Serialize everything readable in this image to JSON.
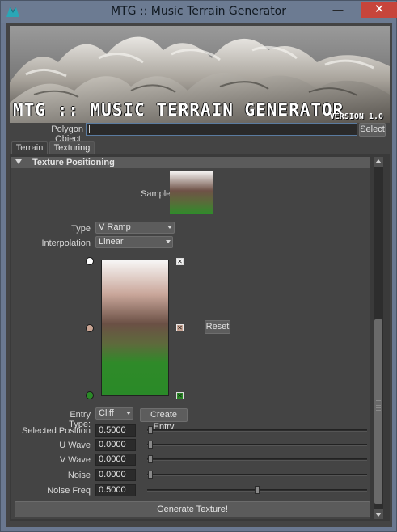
{
  "window": {
    "title": "MTG :: Music Terrain Generator",
    "minimize_glyph": "—",
    "maximize_glyph": "□",
    "close_glyph": "✕"
  },
  "banner": {
    "title": "MTG :: MUSIC TERRAIN GENERATOR",
    "version": "VERSION 1.0"
  },
  "polygon": {
    "label": "Polygon Object:",
    "value": "",
    "select_label": "Select"
  },
  "tabs": [
    {
      "label": "Terrain",
      "active": false
    },
    {
      "label": "Texturing",
      "active": true
    }
  ],
  "section": {
    "title": "Texture Positioning",
    "expanded": true
  },
  "sample": {
    "label": "Sample"
  },
  "type": {
    "label": "Type",
    "selected": "V Ramp"
  },
  "interpolation": {
    "label": "Interpolation",
    "selected": "Linear"
  },
  "ramp": {
    "reset_label": "Reset",
    "colors": {
      "top": "#ffffff",
      "middle": "#6b5045",
      "bottom": "#2b8a28"
    }
  },
  "entry": {
    "label": "Entry Type:",
    "selected": "Cliff",
    "create_label": "Create Entry"
  },
  "fields": [
    {
      "label": "Selected Position",
      "value": "0.5000",
      "slider": 0.0
    },
    {
      "label": "U Wave",
      "value": "0.0000",
      "slider": 0.0
    },
    {
      "label": "V Wave",
      "value": "0.0000",
      "slider": 0.0
    },
    {
      "label": "Noise",
      "value": "0.0000",
      "slider": 0.0
    },
    {
      "label": "Noise Freq",
      "value": "0.5000",
      "slider": 0.5
    }
  ],
  "generate_label": "Generate Texture!",
  "colors": {
    "panel_bg": "#444444",
    "close_button": "#c7453b",
    "input_focus": "#5a7ba0"
  }
}
